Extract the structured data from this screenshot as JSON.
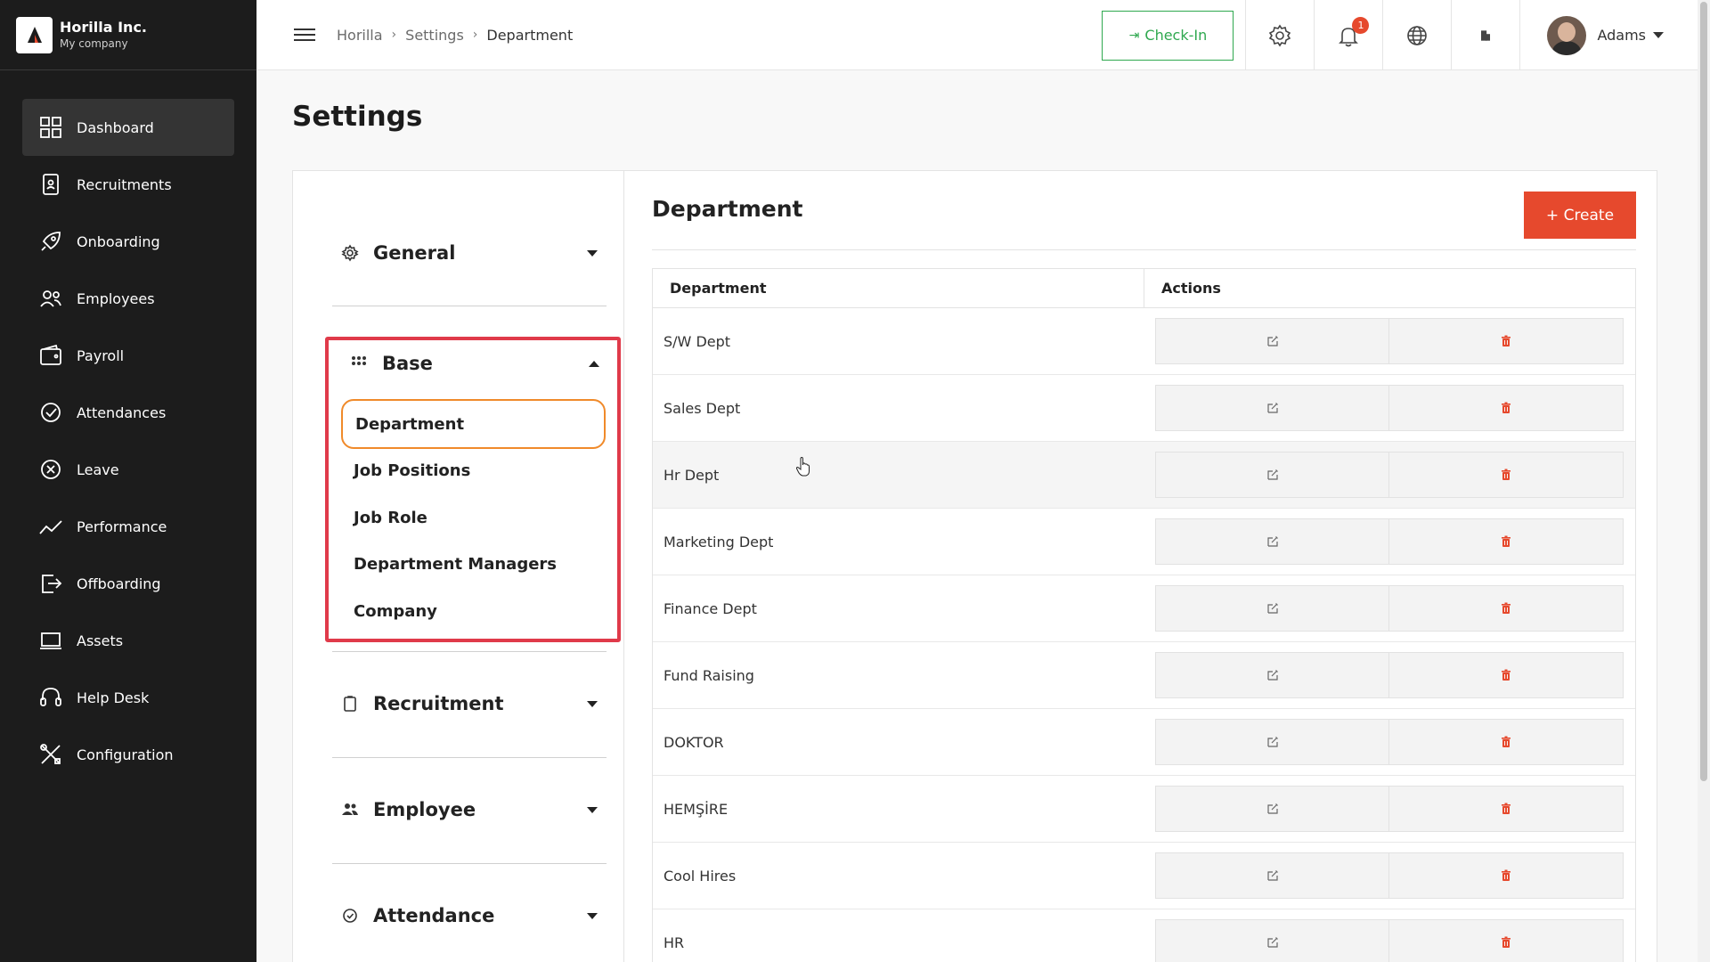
{
  "brand": {
    "name": "Horilla Inc.",
    "sub": "My company"
  },
  "sidebar": {
    "items": [
      {
        "label": "Dashboard",
        "icon": "dashboard-icon",
        "active": true
      },
      {
        "label": "Recruitments",
        "icon": "recruitment-icon"
      },
      {
        "label": "Onboarding",
        "icon": "rocket-icon"
      },
      {
        "label": "Employees",
        "icon": "users-icon"
      },
      {
        "label": "Payroll",
        "icon": "wallet-icon"
      },
      {
        "label": "Attendances",
        "icon": "check-circle-icon"
      },
      {
        "label": "Leave",
        "icon": "x-circle-icon"
      },
      {
        "label": "Performance",
        "icon": "trend-icon"
      },
      {
        "label": "Offboarding",
        "icon": "exit-icon"
      },
      {
        "label": "Assets",
        "icon": "laptop-icon"
      },
      {
        "label": "Help Desk",
        "icon": "headset-icon"
      },
      {
        "label": "Configuration",
        "icon": "tools-icon"
      }
    ]
  },
  "header": {
    "breadcrumb": [
      "Horilla",
      "Settings",
      "Department"
    ],
    "checkin_label": "Check-In",
    "notification_count": "1",
    "user_name": "Adams"
  },
  "main": {
    "title": "Settings",
    "settings_nav": {
      "general": "General",
      "base": "Base",
      "base_items": [
        "Department",
        "Job Positions",
        "Job Role",
        "Department Managers",
        "Company"
      ],
      "recruitment": "Recruitment",
      "employee": "Employee",
      "attendance": "Attendance"
    },
    "department": {
      "title": "Department",
      "create_label": "+ Create",
      "columns": [
        "Department",
        "Actions"
      ],
      "rows": [
        "S/W Dept",
        "Sales Dept",
        "Hr Dept",
        "Marketing Dept",
        "Finance Dept",
        "Fund Raising",
        "DOKTOR",
        "HEMŞİRE",
        "Cool Hires",
        "HR"
      ]
    }
  },
  "colors": {
    "accent": "#e6492d",
    "checkin": "#2fa84f",
    "highlight_box": "#e03a4a",
    "active_item": "#f08a2a"
  }
}
